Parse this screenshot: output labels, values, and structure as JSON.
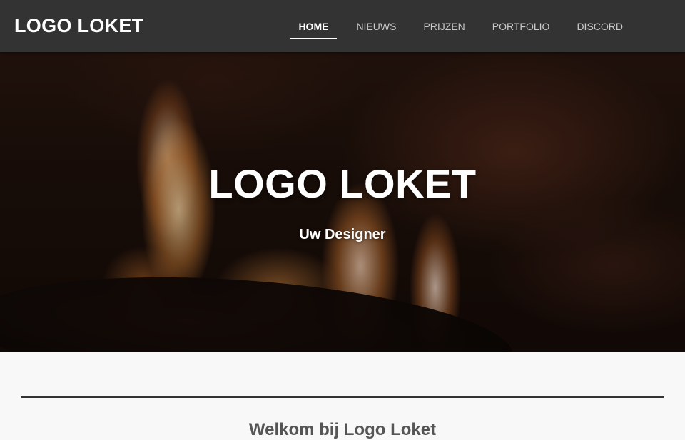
{
  "header": {
    "brand": "LOGO LOKET",
    "nav": [
      {
        "label": "HOME",
        "active": true
      },
      {
        "label": "NIEUWS",
        "active": false
      },
      {
        "label": "PRIJZEN",
        "active": false
      },
      {
        "label": "PORTFOLIO",
        "active": false
      },
      {
        "label": "DISCORD",
        "active": false
      }
    ]
  },
  "hero": {
    "title": "LOGO LOKET",
    "subtitle": "Uw Designer"
  },
  "section": {
    "heading": "Welkom bij Logo Loket"
  },
  "colors": {
    "navbar": "#333333",
    "nav_text": "#c9c9c9",
    "nav_active": "#ffffff",
    "page_bg": "#f8f8f8"
  }
}
